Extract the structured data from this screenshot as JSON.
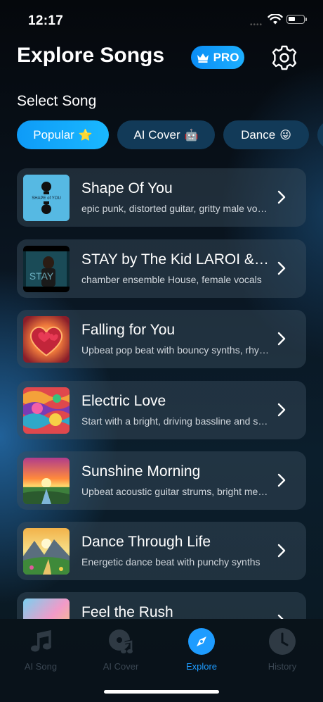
{
  "status_bar": {
    "time": "12:17"
  },
  "header": {
    "title": "Explore Songs",
    "pro_label": "PRO"
  },
  "select_label": "Select Song",
  "chips": [
    {
      "label": "Popular",
      "emoji": "⭐",
      "active": true
    },
    {
      "label": "AI Cover",
      "emoji": "🤖",
      "active": false
    },
    {
      "label": "Dance",
      "emoji": "😜",
      "active": false
    }
  ],
  "songs": [
    {
      "title": "Shape Of You",
      "desc": "epic punk,  distorted guitar,  gritty male vocals"
    },
    {
      "title": "STAY by The Kid LAROI & Justin Bieber",
      "desc": "chamber ensemble House, female vocals"
    },
    {
      "title": "Falling for You",
      "desc": "Upbeat pop beat with bouncy synths, rhythmic"
    },
    {
      "title": "Electric Love",
      "desc": "Start with a bright, driving bassline and synths"
    },
    {
      "title": "Sunshine Morning",
      "desc": "Upbeat acoustic guitar strums, bright melodies"
    },
    {
      "title": "Dance Through Life",
      "desc": "Energetic dance beat with punchy synths"
    },
    {
      "title": "Feel the Rush",
      "desc": ""
    }
  ],
  "thumb_texts": {
    "song1_cover": "SHAPE of YOU",
    "song2_cover": "STAY"
  },
  "tabs": [
    {
      "label": "AI Song",
      "icon": "music-note-icon",
      "active": false
    },
    {
      "label": "AI Cover",
      "icon": "disc-icon",
      "active": false
    },
    {
      "label": "Explore",
      "icon": "compass-icon",
      "active": true
    },
    {
      "label": "History",
      "icon": "clock-icon",
      "active": false
    }
  ],
  "colors": {
    "accent": "#1e9cff",
    "pro_badge": "#0a8df5",
    "chip_inactive": "#123a58"
  }
}
